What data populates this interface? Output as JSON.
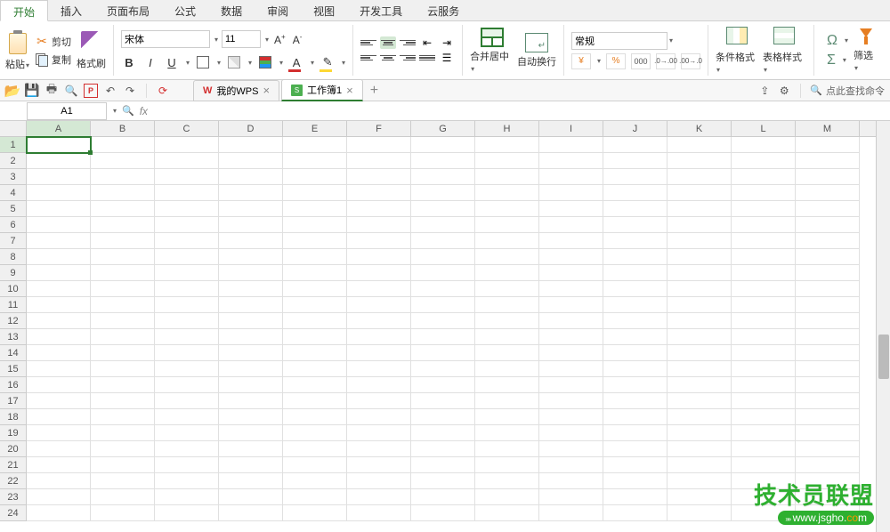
{
  "menu_tabs": [
    "开始",
    "插入",
    "页面布局",
    "公式",
    "数据",
    "审阅",
    "视图",
    "开发工具",
    "云服务"
  ],
  "active_tab": 0,
  "ribbon": {
    "paste": "粘贴",
    "cut": "剪切",
    "copy": "复制",
    "format_painter": "格式刷",
    "font_name": "宋体",
    "font_size": "11",
    "increase_font": "A⁺",
    "decrease_font": "A⁻",
    "bold": "B",
    "italic": "I",
    "underline": "U",
    "font_color_letter": "A",
    "merge_center": "合并居中",
    "wrap_text": "自动换行",
    "number_format": "常规",
    "cond_format": "条件格式",
    "table_style": "表格样式",
    "autosum": "Σ",
    "symbol": "Ω",
    "filter": "筛选"
  },
  "doc_tabs": [
    {
      "label": "我的WPS",
      "type": "wps"
    },
    {
      "label": "工作簿1",
      "type": "xls",
      "active": true
    }
  ],
  "search_placeholder": "点此查找命令",
  "name_box": "A1",
  "fx_label": "fx",
  "columns": [
    "A",
    "B",
    "C",
    "D",
    "E",
    "F",
    "G",
    "H",
    "I",
    "J",
    "K",
    "L",
    "M"
  ],
  "rows": [
    1,
    2,
    3,
    4,
    5,
    6,
    7,
    8,
    9,
    10,
    11,
    12,
    13,
    14,
    15,
    16,
    17,
    18,
    19,
    20,
    21,
    22,
    23,
    24
  ],
  "active_cell": {
    "row": 1,
    "col": "A"
  },
  "watermark": {
    "main": "技术员联盟",
    "url_pre": "www.",
    "url_mid": "jsgho",
    "url_suf": ".com"
  }
}
